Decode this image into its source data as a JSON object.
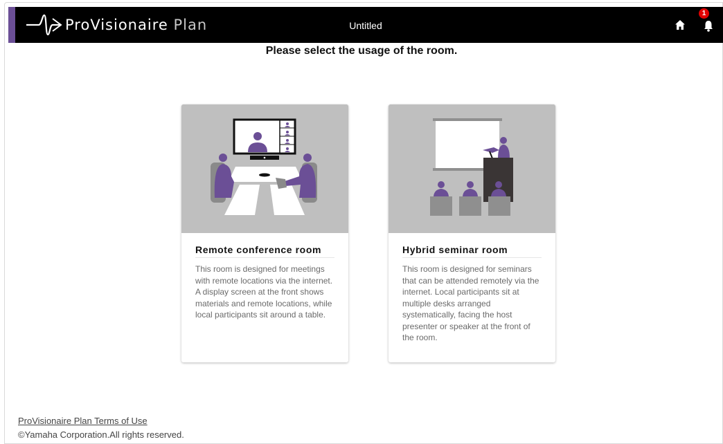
{
  "app": {
    "brand_main": "ProVisionaire",
    "brand_sub": "Plan",
    "document_title": "Untitled",
    "notification_count": "1"
  },
  "main": {
    "prompt": "Please select the usage of the room."
  },
  "cards": [
    {
      "title": "Remote conference room",
      "description": "This room is designed for meetings with remote locations via the internet. A display screen at the front shows materials and remote locations, while local participants sit around a table."
    },
    {
      "title": "Hybrid seminar room",
      "description": "This room is designed for seminars that can be attended remotely via the internet. Local participants sit at multiple desks arranged systematically, facing the host presenter or speaker at the front of the room."
    }
  ],
  "footer": {
    "terms_link": "ProVisionaire Plan Terms of Use",
    "copyright": "©Yamaha Corporation.All rights reserved."
  },
  "colors": {
    "accent": "#6b4f96",
    "topbar": "#000000",
    "badge": "#e00000",
    "illustration_bg": "#bfbfbf"
  },
  "icons": [
    "logo-mark-icon",
    "home-icon",
    "bell-icon"
  ]
}
